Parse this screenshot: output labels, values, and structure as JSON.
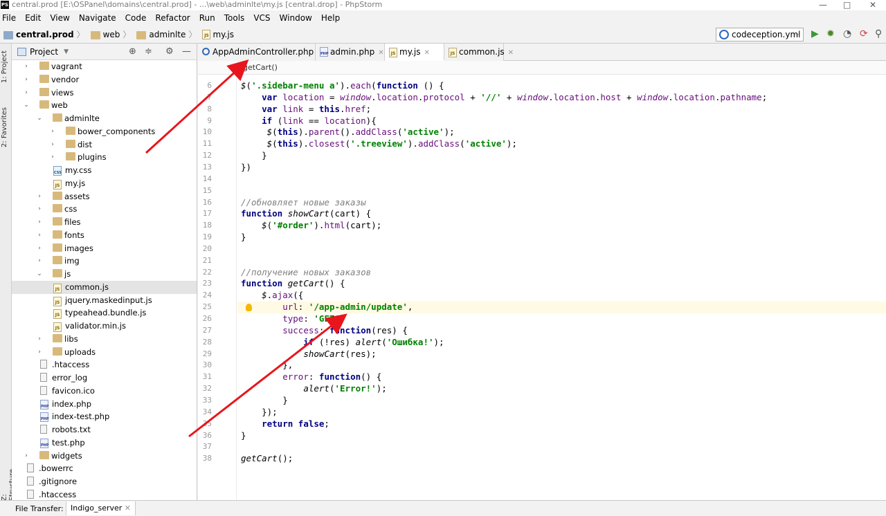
{
  "window": {
    "title": "central.prod [E:\\OSPanel\\domains\\central.prod] - ...\\web\\adminlte\\my.js [central.drop] - PhpStorm",
    "logo": "PS",
    "min": "—",
    "max": "□",
    "close": "✕"
  },
  "menu": [
    "File",
    "Edit",
    "View",
    "Navigate",
    "Code",
    "Refactor",
    "Run",
    "Tools",
    "VCS",
    "Window",
    "Help"
  ],
  "breadcrumb": [
    "central.prod",
    "web",
    "adminlte",
    "my.js"
  ],
  "run_config": "codeception.yml",
  "side_tabs": {
    "project": "1: Project",
    "favorites": "2: Favorites",
    "structure": "Z: Structure"
  },
  "project_panel": {
    "title": "Project"
  },
  "tree": [
    {
      "label": "vagrant",
      "type": "folder",
      "level": 1,
      "arrow": "›"
    },
    {
      "label": "vendor",
      "type": "folder",
      "level": 1,
      "arrow": "›"
    },
    {
      "label": "views",
      "type": "folder",
      "level": 1,
      "arrow": "›"
    },
    {
      "label": "web",
      "type": "folder",
      "level": 1,
      "arrow": "⌄"
    },
    {
      "label": "adminlte",
      "type": "folder",
      "level": 2,
      "arrow": "⌄"
    },
    {
      "label": "bower_components",
      "type": "folder",
      "level": 3,
      "arrow": "›"
    },
    {
      "label": "dist",
      "type": "folder",
      "level": 3,
      "arrow": "›"
    },
    {
      "label": "plugins",
      "type": "folder",
      "level": 3,
      "arrow": "›"
    },
    {
      "label": "my.css",
      "type": "css",
      "level": 3,
      "arrow": ""
    },
    {
      "label": "my.js",
      "type": "js",
      "level": 3,
      "arrow": ""
    },
    {
      "label": "assets",
      "type": "folder",
      "level": 2,
      "arrow": "›"
    },
    {
      "label": "css",
      "type": "folder",
      "level": 2,
      "arrow": "›"
    },
    {
      "label": "files",
      "type": "folder",
      "level": 2,
      "arrow": "›"
    },
    {
      "label": "fonts",
      "type": "folder",
      "level": 2,
      "arrow": "›"
    },
    {
      "label": "images",
      "type": "folder",
      "level": 2,
      "arrow": "›"
    },
    {
      "label": "img",
      "type": "folder",
      "level": 2,
      "arrow": "›"
    },
    {
      "label": "js",
      "type": "folder",
      "level": 2,
      "arrow": "⌄"
    },
    {
      "label": "common.js",
      "type": "js",
      "level": 3,
      "arrow": "",
      "selected": true
    },
    {
      "label": "jquery.maskedinput.js",
      "type": "js",
      "level": 3,
      "arrow": ""
    },
    {
      "label": "typeahead.bundle.js",
      "type": "js",
      "level": 3,
      "arrow": ""
    },
    {
      "label": "validator.min.js",
      "type": "js",
      "level": 3,
      "arrow": ""
    },
    {
      "label": "libs",
      "type": "folder",
      "level": 2,
      "arrow": "›"
    },
    {
      "label": "uploads",
      "type": "folder",
      "level": 2,
      "arrow": "›"
    },
    {
      "label": ".htaccess",
      "type": "file",
      "level": 2,
      "arrow": ""
    },
    {
      "label": "error_log",
      "type": "file",
      "level": 2,
      "arrow": ""
    },
    {
      "label": "favicon.ico",
      "type": "file",
      "level": 2,
      "arrow": ""
    },
    {
      "label": "index.php",
      "type": "php",
      "level": 2,
      "arrow": ""
    },
    {
      "label": "index-test.php",
      "type": "php",
      "level": 2,
      "arrow": ""
    },
    {
      "label": "robots.txt",
      "type": "file",
      "level": 2,
      "arrow": ""
    },
    {
      "label": "test.php",
      "type": "php",
      "level": 2,
      "arrow": ""
    },
    {
      "label": "widgets",
      "type": "folder",
      "level": 1,
      "arrow": "›"
    },
    {
      "label": ".bowerrc",
      "type": "file",
      "level": 1,
      "arrow": ""
    },
    {
      "label": ".gitignore",
      "type": "file",
      "level": 1,
      "arrow": ""
    },
    {
      "label": ".htaccess",
      "type": "file",
      "level": 1,
      "arrow": ""
    }
  ],
  "tabs": [
    {
      "label": "AppAdminController.php",
      "icon": "class"
    },
    {
      "label": "admin.php",
      "icon": "php"
    },
    {
      "label": "my.js",
      "icon": "js",
      "active": true
    },
    {
      "label": "common.js",
      "icon": "js"
    }
  ],
  "editor_breadcrumb": "getCart()",
  "lines": [
    {
      "n": "6",
      "html": "<span class=\"f\">$</span>(<span class=\"s\">'.sidebar-menu a'</span>).<span class=\"m\">each</span>(<span class=\"k\">function</span> () {"
    },
    {
      "n": "7",
      "html": "    <span class=\"k\">var</span> <span class=\"m\">location</span> = <span class=\"mi\">window</span>.<span class=\"m\">location</span>.<span class=\"m\">protocol</span> + <span class=\"s\">'//'</span> + <span class=\"mi\">window</span>.<span class=\"m\">location</span>.<span class=\"m\">host</span> + <span class=\"mi\">window</span>.<span class=\"m\">location</span>.<span class=\"m\">pathname</span>;"
    },
    {
      "n": "8",
      "html": "    <span class=\"k\">var</span> <span class=\"m\">link</span> = <span class=\"k\">this</span>.<span class=\"m\">href</span>;"
    },
    {
      "n": "9",
      "html": "    <span class=\"k\">if</span> (<span class=\"m\">link</span> == <span class=\"m\">location</span>){"
    },
    {
      "n": "10",
      "html": "     <span class=\"f\">$</span>(<span class=\"k\">this</span>).<span class=\"m\">parent</span>().<span class=\"m\">addClass</span>(<span class=\"s\">'active'</span>);"
    },
    {
      "n": "11",
      "html": "     <span class=\"f\">$</span>(<span class=\"k\">this</span>).<span class=\"m\">closest</span>(<span class=\"s\">'.treeview'</span>).<span class=\"m\">addClass</span>(<span class=\"s\">'active'</span>);"
    },
    {
      "n": "12",
      "html": "    }"
    },
    {
      "n": "13",
      "html": "})"
    },
    {
      "n": "14",
      "html": ""
    },
    {
      "n": "15",
      "html": ""
    },
    {
      "n": "16",
      "html": "<span class=\"c\">//обновляет новые заказы</span>"
    },
    {
      "n": "17",
      "html": "<span class=\"k\">function</span> <span class=\"f\">showCart</span>(cart) {"
    },
    {
      "n": "18",
      "html": "    <span class=\"f\">$</span>(<span class=\"s\">'#order'</span>).<span class=\"m\">html</span>(cart);"
    },
    {
      "n": "19",
      "html": "}"
    },
    {
      "n": "20",
      "html": ""
    },
    {
      "n": "21",
      "html": ""
    },
    {
      "n": "22",
      "html": "<span class=\"c\">//получение новых заказов</span>"
    },
    {
      "n": "23",
      "html": "<span class=\"k\">function</span> <span class=\"f\">getCart</span>() {"
    },
    {
      "n": "24",
      "html": "    <span class=\"f\">$</span>.<span class=\"m\">ajax</span>({"
    },
    {
      "n": "25",
      "html": "        <span class=\"m\">url</span>: <span class=\"s\">'/app-admin/update'</span>,"
    },
    {
      "n": "26",
      "html": "        <span class=\"m\">type</span>: <span class=\"s\">'GET'</span>,"
    },
    {
      "n": "27",
      "html": "        <span class=\"m\">success</span>: <span class=\"k\">function</span>(res) {"
    },
    {
      "n": "28",
      "html": "            <span class=\"k\">if</span> (!res) <span class=\"f\">alert</span>(<span class=\"s\">'Ошибка!'</span>);"
    },
    {
      "n": "29",
      "html": "            <span class=\"f\">showCart</span>(res);"
    },
    {
      "n": "30",
      "html": "        },"
    },
    {
      "n": "31",
      "html": "        <span class=\"m\">error</span>: <span class=\"k\">function</span>() {"
    },
    {
      "n": "32",
      "html": "            <span class=\"f\">alert</span>(<span class=\"s\">'Error!'</span>);"
    },
    {
      "n": "33",
      "html": "        }"
    },
    {
      "n": "34",
      "html": "    });"
    },
    {
      "n": "35",
      "html": "    <span class=\"k\">return false</span>;"
    },
    {
      "n": "36",
      "html": "}"
    },
    {
      "n": "37",
      "html": ""
    },
    {
      "n": "38",
      "html": "<span class=\"f\">getCart</span>();"
    }
  ],
  "highlight_line": "25",
  "status": {
    "label": "File Transfer:",
    "server": "Indigo_server",
    "close": "✕"
  },
  "colors": {
    "keyword": "#000080",
    "string": "#008000",
    "field": "#660e7a",
    "comment": "#808080",
    "annotation_arrow": "#e8151c"
  }
}
